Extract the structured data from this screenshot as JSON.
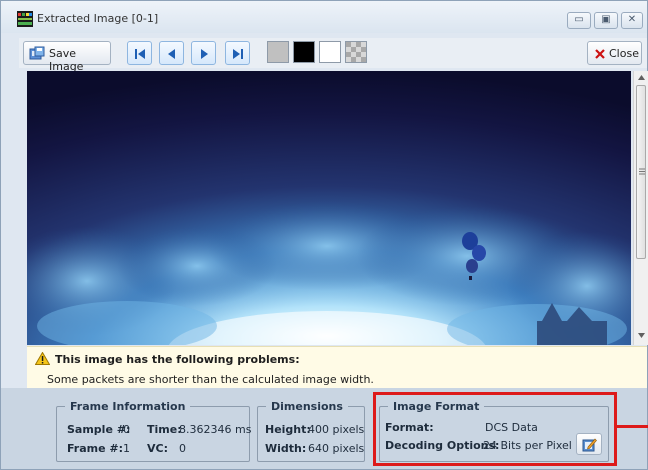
{
  "window": {
    "title": "Extracted Image [0-1]",
    "minimize_glyph": "▭",
    "maximize_glyph": "▣",
    "close_glyph": "✕"
  },
  "toolbar": {
    "save_label": "Save Image",
    "close_label": "Close",
    "nav_icons": [
      "first-frame-icon",
      "previous-frame-icon",
      "next-frame-icon",
      "last-frame-icon"
    ],
    "background_swatches": [
      {
        "name": "gray",
        "color": "#c0c0c0"
      },
      {
        "name": "black",
        "color": "#000000"
      },
      {
        "name": "white",
        "color": "#ffffff"
      },
      {
        "name": "checkerboard",
        "color": "#bfbfbf"
      }
    ]
  },
  "warning": {
    "title": "This image has the following problems:",
    "detail": "Some packets are shorter than the calculated image width."
  },
  "frame_info": {
    "legend": "Frame Information",
    "sample_label": "Sample #:",
    "sample_value": "0",
    "time_label": "Time:",
    "time_value": "8.362346 ms",
    "frame_label": "Frame #:",
    "frame_value": "1",
    "vc_label": "VC:",
    "vc_value": "0"
  },
  "dimensions": {
    "legend": "Dimensions",
    "height_label": "Height:",
    "height_value": "400 pixels",
    "width_label": "Width:",
    "width_value": "640 pixels"
  },
  "image_format": {
    "legend": "Image Format",
    "format_label": "Format:",
    "format_value": "DCS Data",
    "decoding_label": "Decoding Options:",
    "decoding_value": "24 Bits per Pixel"
  },
  "colors": {
    "accent_highlight": "#dd1a1a",
    "close_x": "#cc1111",
    "nav_blue": "#1e5fb4",
    "sky_dark": "#0e1032",
    "sky_glow": "#b9e6ff"
  }
}
